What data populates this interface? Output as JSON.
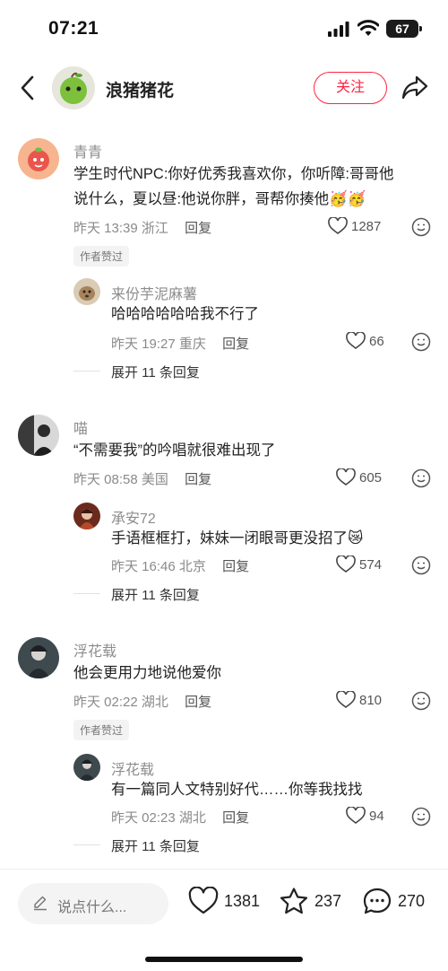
{
  "status": {
    "time": "07:21",
    "battery": "67"
  },
  "header": {
    "name": "浪猪猪花",
    "follow_label": "关注"
  },
  "comments": [
    {
      "user": "青青",
      "text_lines": [
        "学生时代NPC:你好优秀我喜欢你，你听障:哥哥他",
        "说什么，夏以昼:他说你胖，哥帮你揍他🥳🥳"
      ],
      "time": "昨天 13:39",
      "location": "浙江",
      "reply_label": "回复",
      "likes": "1287",
      "author_liked": "作者赞过",
      "sub": {
        "user": "来份芋泥麻薯",
        "text": "哈哈哈哈哈哈我不行了",
        "time": "昨天 19:27",
        "location": "重庆",
        "reply_label": "回复",
        "likes": "66"
      },
      "expand": "展开 11 条回复"
    },
    {
      "user": "喵",
      "text_lines": [
        "“不需要我”的吟唱就很难出现了"
      ],
      "time": "昨天 08:58",
      "location": "美国",
      "reply_label": "回复",
      "likes": "605",
      "sub": {
        "user": "承安72",
        "text": "手语框框打，妹妹一闭眼哥更没招了😿",
        "time": "昨天 16:46",
        "location": "北京",
        "reply_label": "回复",
        "likes": "574"
      },
      "expand": "展开 11 条回复"
    },
    {
      "user": "浮花载",
      "text_lines": [
        "他会更用力地说他爱你"
      ],
      "time": "昨天 02:22",
      "location": "湖北",
      "reply_label": "回复",
      "likes": "810",
      "author_liked": "作者赞过",
      "sub": {
        "user": "浮花载",
        "text": "有一篇同人文特别好代……你等我找找",
        "time": "昨天 02:23",
        "location": "湖北",
        "reply_label": "回复",
        "likes": "94"
      },
      "expand": "展开 11 条回复"
    }
  ],
  "bottom": {
    "placeholder": "说点什么...",
    "likes": "1381",
    "stars": "237",
    "comments": "270"
  },
  "colors": {
    "accent": "#ff2442",
    "meta": "#8a8a8a"
  }
}
